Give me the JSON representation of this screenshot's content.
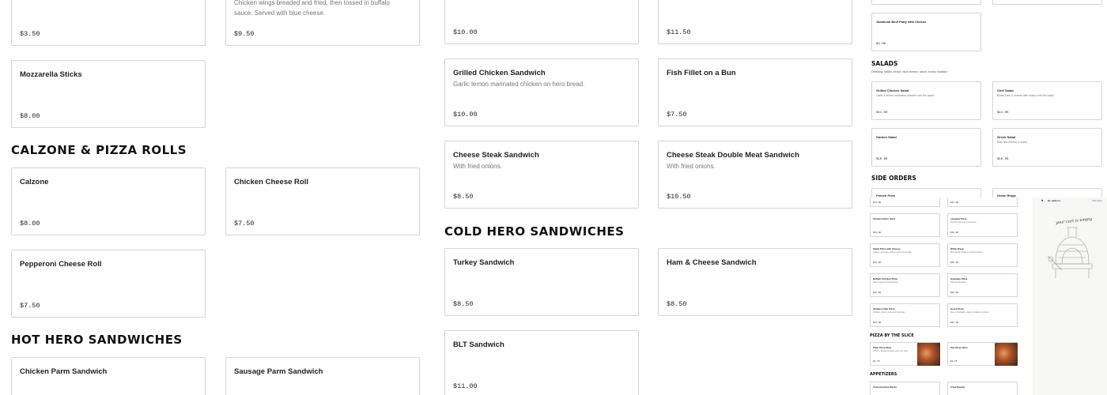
{
  "col1": {
    "top_items": [
      {
        "price": "$3.50"
      },
      {
        "desc": "Chicken wings breaded and fried, then tossed in buffalo sauce. Served with blue cheese.",
        "price": "$9.50"
      }
    ],
    "mozzarella": {
      "name": "Mozzarella Sticks",
      "price": "$8.00"
    },
    "calzone_heading": "CALZONE & PIZZA ROLLS",
    "calzone_items": [
      {
        "name": "Calzone",
        "price": "$8.00"
      },
      {
        "name": "Chicken Cheese Roll",
        "price": "$7.50"
      },
      {
        "name": "Pepperoni Cheese Roll",
        "price": "$7.50"
      }
    ],
    "hot_heading": "HOT HERO SANDWICHES",
    "hot_items": [
      {
        "name": "Chicken Parm Sandwich"
      },
      {
        "name": "Sausage Parm Sandwich"
      }
    ]
  },
  "col2": {
    "top_items": [
      {
        "price": "$10.00"
      },
      {
        "price": "$11.50"
      }
    ],
    "items": [
      {
        "name": "Grilled Chicken Sandwich",
        "desc": "Garlic lemon marinated chicken on hero bread.",
        "price": "$10.00"
      },
      {
        "name": "Fish Fillet on a Bun",
        "price": "$7.50"
      },
      {
        "name": "Cheese Steak Sandwich",
        "desc": "With fried onions.",
        "price": "$8.50"
      },
      {
        "name": "Cheese Steak Double Meat Sandwich",
        "desc": "With fried onions.",
        "price": "$10.50"
      }
    ],
    "cold_heading": "COLD HERO SANDWICHES",
    "cold_items": [
      {
        "name": "Turkey Sandwich",
        "price": "$8.50"
      },
      {
        "name": "Ham & Cheese Sandwich",
        "price": "$8.50"
      },
      {
        "name": "BLT Sandwich",
        "price": "$11.00"
      }
    ]
  },
  "thumb1": {
    "patty": {
      "name": "Jamaican Beef Patty with Cheese",
      "price": "$4.00"
    },
    "salads_heading": "SALADS",
    "salads_sub": "Dressing: italian, french, blue cheese, ranch, honey mustard.",
    "salads": [
      {
        "name": "Grilled Chicken Salad",
        "desc": "Garlic & lemon marinated chicken over the salad.",
        "price": "$11.00"
      },
      {
        "name": "Chef Salad",
        "desc": "Boiled ham & cheese with turkey over the salad.",
        "price": "$11.00"
      },
      {
        "name": "Garden Salad",
        "price": "$10.00"
      },
      {
        "name": "Greek Salad",
        "desc": "With feta cheese & olives.",
        "price": "$10.50"
      }
    ],
    "side_heading": "SIDE ORDERS",
    "sides": [
      {
        "name": "French Fries"
      },
      {
        "name": "Onion Rings"
      }
    ]
  },
  "thumb2": {
    "top_prices": [
      "$17.00",
      "$21.00"
    ],
    "pizzas": [
      {
        "name": "Chicken Parm Pizza",
        "price": "$21.00"
      },
      {
        "name": "Lasagna Pizza",
        "desc": "Ricotta cheese & meat sauce.",
        "price": "$21.00"
      },
      {
        "name": "Salad Pizza with Cheese",
        "desc": "Lettuce, tomatoes, onions, and oil & vinegar.",
        "price": "$21.00"
      },
      {
        "name": "White Pizza",
        "desc": "Mozzarella, ricotta & romano cheese.",
        "price": "$19.00"
      },
      {
        "name": "Buffalo Chicken Pizza",
        "desc": "Spicy crispy & chunks sauce.",
        "price": "$21.00"
      },
      {
        "name": "Hawaiian Pizza",
        "desc": "Ham & pineapple.",
        "price": "$21.00"
      },
      {
        "name": "Chicken Club Pizza",
        "desc": "Chicken, bacon, and ranch dressing.",
        "price": "$21.00"
      },
      {
        "name": "Greek Pizza",
        "desc": "Feta, mozzarella, olives, tomatoes & onions.",
        "price": "$21.00"
      }
    ],
    "slice_heading": "PIZZA BY THE SLICE",
    "slices": [
      {
        "name": "Plain Pizza Slice",
        "desc": "Cheese, tomato & sauce your own slice.",
        "price": "$2.75"
      },
      {
        "name": "Pan Pizza Slice",
        "price": "$2.75"
      }
    ],
    "appetizers_heading": "APPETIZERS",
    "appetizers": [
      {
        "name": "Fried Zucchini Sticks"
      },
      {
        "name": "Fried Ravioli"
      }
    ]
  },
  "thumb3": {
    "address": "No address",
    "right_text": "Visit store",
    "script_text": "your cart is empty"
  }
}
